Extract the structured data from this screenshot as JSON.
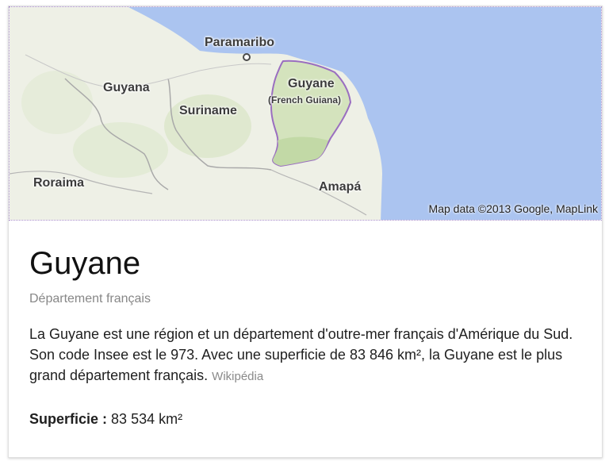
{
  "map": {
    "labels": {
      "paramaribo": "Paramaribo",
      "guyana": "Guyana",
      "suriname": "Suriname",
      "guyane": "Guyane",
      "french_guiana": "(French Guiana)",
      "roraima": "Roraima",
      "amapa": "Amapá"
    },
    "attribution": "Map data ©2013 Google, MapLink",
    "colors": {
      "ocean": "#abc4f0",
      "land": "#eef0e6",
      "highlight_fill": "#d4e3bd",
      "highlight_border": "#9a6ec0",
      "forest": "#c2d9a6"
    }
  },
  "entity": {
    "title": "Guyane",
    "subtitle": "Département français",
    "description": "La Guyane est une région et un département d'outre-mer français d'Amérique du Sud. Son code Insee est le 973. Avec une superficie de 83 846 km², la Guyane est le plus grand département français.",
    "source": "Wikipédia"
  },
  "facts": [
    {
      "label": "Superficie",
      "separator": " :",
      "value": "83 534 km²"
    }
  ]
}
